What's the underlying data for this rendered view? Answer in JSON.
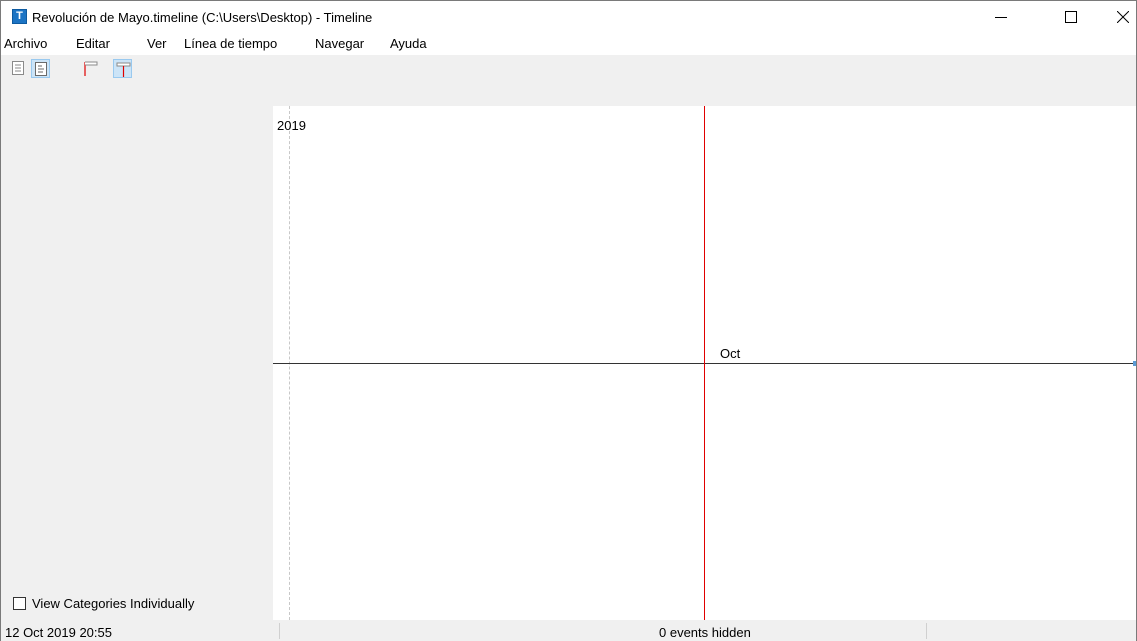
{
  "window": {
    "app_icon_letter": "T",
    "title": "Revolución de Mayo.timeline (C:\\Users\\Desktop) - Timeline"
  },
  "menu": {
    "items": [
      "Archivo",
      "Editar",
      "Ver",
      "Línea de tiempo",
      "Navegar",
      "Ayuda"
    ]
  },
  "toolbar": {
    "buttons": [
      {
        "icon": "event-list-icon",
        "active": false
      },
      {
        "icon": "event-detail-icon",
        "active": true
      },
      {
        "icon": "flag-icon",
        "active": false
      },
      {
        "icon": "period-marker-icon",
        "active": true
      }
    ]
  },
  "sidebar": {
    "view_categories_label": "View Categories Individually",
    "view_categories_checked": false
  },
  "timeline": {
    "year_label": "2019",
    "month_label": "Oct",
    "now_line_color": "#e00000"
  },
  "status": {
    "current_time": "12 Oct 2019 20:55",
    "hidden_events": "0 events hidden"
  }
}
